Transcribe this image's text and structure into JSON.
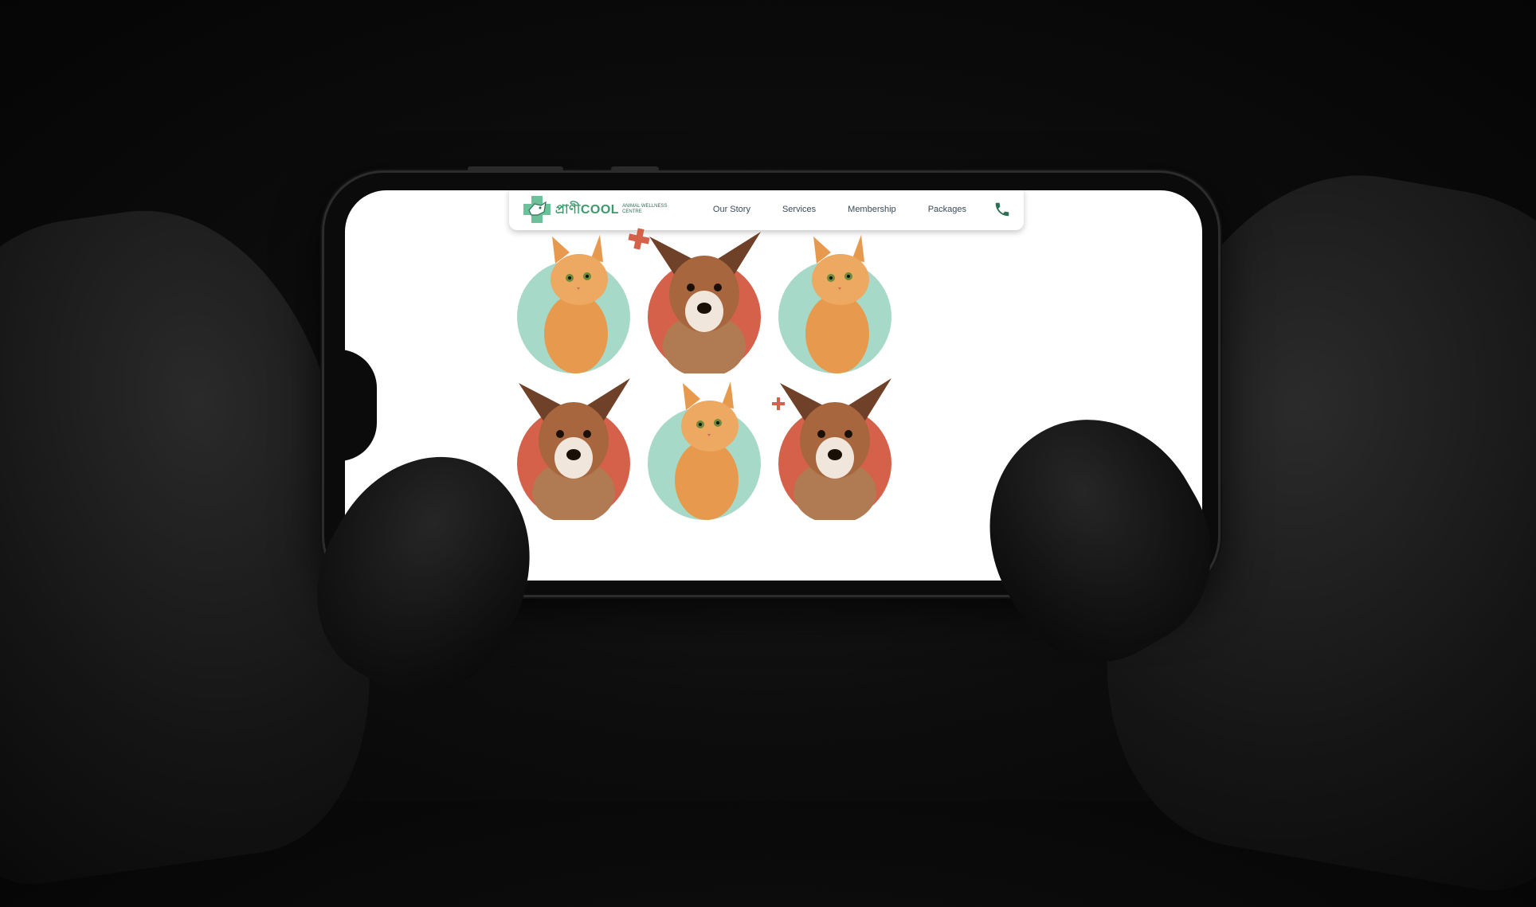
{
  "site": {
    "logo_name": "প্রাণীCOOL",
    "logo_subtitle": "Animal Wellness Centre",
    "nav": [
      "Our Story",
      "Services",
      "Membership",
      "Packages"
    ],
    "call_icon": "phone-icon"
  },
  "grid": {
    "rows": [
      [
        "cat",
        "dog",
        "cat"
      ],
      [
        "dog",
        "cat",
        "dog"
      ]
    ]
  },
  "colors": {
    "mint": "#a7d9c8",
    "coral": "#d6614a",
    "brand_green": "#3a9a6a",
    "cat_fur": "#e79a4e",
    "dog_fur": "#a7663d"
  }
}
